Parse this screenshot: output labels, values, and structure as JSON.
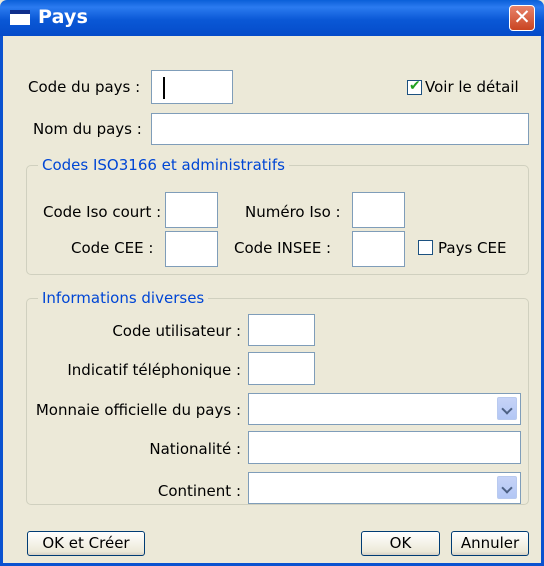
{
  "window": {
    "title": "Pays",
    "close_symbol": "✕"
  },
  "fields": {
    "code_pays_label": "Code du pays :",
    "voir_detail_label": "Voir le détail",
    "voir_detail_checked": true,
    "nom_pays_label": "Nom du pays :"
  },
  "iso_group": {
    "legend": "Codes ISO3166 et administratifs",
    "code_iso_court_label": "Code Iso court :",
    "numero_iso_label": "Numéro Iso :",
    "code_cee_label": "Code CEE :",
    "code_insee_label": "Code INSEE :",
    "pays_cee_label": "Pays CEE",
    "pays_cee_checked": false
  },
  "info_group": {
    "legend": "Informations diverses",
    "code_utilisateur_label": "Code utilisateur :",
    "indicatif_label": "Indicatif téléphonique :",
    "monnaie_label": "Monnaie officielle du pays :",
    "nationalite_label": "Nationalité :",
    "continent_label": "Continent :"
  },
  "buttons": {
    "ok_creer": "OK et Créer",
    "ok": "OK",
    "annuler": "Annuler"
  }
}
